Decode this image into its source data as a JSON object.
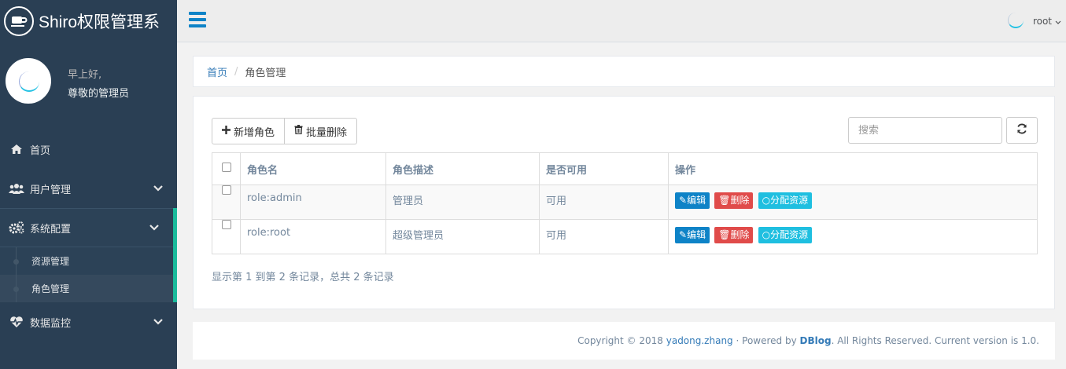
{
  "sidebar": {
    "brand_title": "Shiro权限管理系",
    "greeting": "早上好,",
    "welcome": "尊敬的管理员",
    "menu": [
      {
        "label": "首页",
        "icon": "home-icon"
      },
      {
        "label": "用户管理",
        "icon": "users-icon"
      },
      {
        "label": "系统配置",
        "icon": "gears-icon"
      },
      {
        "label": "数据监控",
        "icon": "heartbeat-icon"
      }
    ],
    "submenu": [
      {
        "label": "资源管理"
      },
      {
        "label": "角色管理"
      }
    ]
  },
  "topbar": {
    "user": "root"
  },
  "breadcrumb": {
    "home": "首页",
    "separator": "/",
    "current": "角色管理"
  },
  "toolbar": {
    "add_label": "新增角色",
    "batch_delete_label": "批量删除",
    "search_placeholder": "搜索"
  },
  "table": {
    "headers": {
      "name": "角色名",
      "desc": "角色描述",
      "enabled": "是否可用",
      "ops": "操作"
    },
    "rows": [
      {
        "name": "role:admin",
        "desc": "管理员",
        "enabled": "可用"
      },
      {
        "name": "role:root",
        "desc": "超级管理员",
        "enabled": "可用"
      }
    ],
    "actions": {
      "edit": "编辑",
      "delete": "删除",
      "assign": "分配资源"
    }
  },
  "summary": "显示第 1 到第 2 条记录，总共 2 条记录",
  "footer": {
    "prefix": "Copyright © 2018",
    "author": "yadong.zhang",
    "mid": "· Powered by",
    "powered": "DBlog",
    "suffix": ". All Rights Reserved. Current version is 1.0."
  },
  "colors": {
    "sidebar_bg": "#2a3f54",
    "accent_green": "#1abb9c",
    "edit_blue": "#0e83c7",
    "delete_red": "#e04b4a",
    "assign_cyan": "#1fbfe0"
  }
}
